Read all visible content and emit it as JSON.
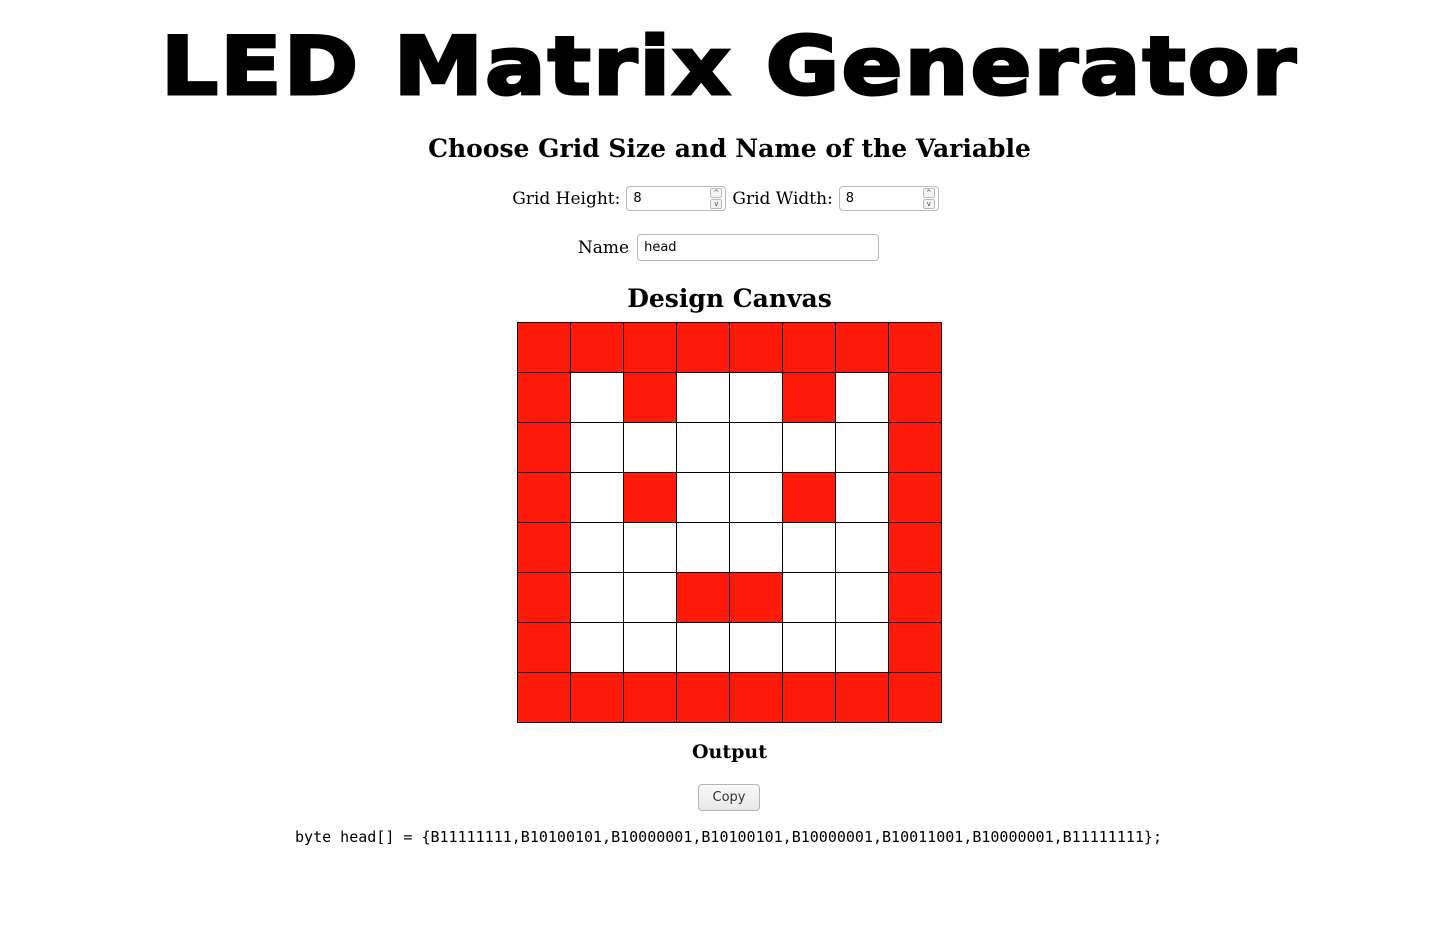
{
  "header": {
    "title": "LED Matrix Generator",
    "subtitle": "Choose Grid Size and Name of the Variable"
  },
  "controls": {
    "grid_height_label": "Grid Height:",
    "grid_height_value": "8",
    "grid_width_label": "Grid Width:",
    "grid_width_value": "8",
    "name_label": "Name",
    "name_value": "head",
    "spin_up_glyph": "^",
    "spin_down_glyph": "v"
  },
  "canvas": {
    "title": "Design Canvas",
    "rows": 8,
    "cols": 8,
    "on_color": "#ff1a0a",
    "off_color": "#ffffff",
    "pattern": [
      "11111111",
      "10100101",
      "10000001",
      "10100101",
      "10000001",
      "10011001",
      "10000001",
      "11111111"
    ]
  },
  "output": {
    "title": "Output",
    "copy_label": "Copy",
    "code": "byte head[] = {B11111111,B10100101,B10000001,B10100101,B10000001,B10011001,B10000001,B11111111};"
  }
}
